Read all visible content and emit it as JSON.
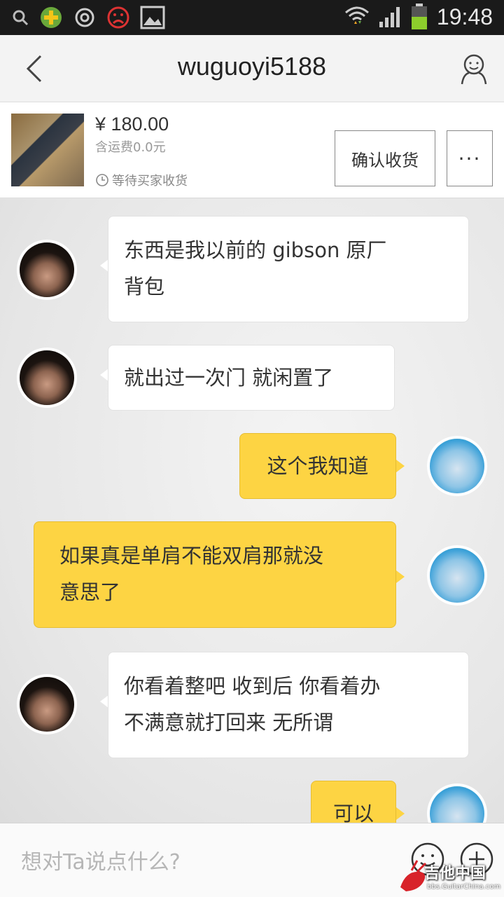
{
  "status_bar": {
    "time": "19:48",
    "icons": [
      "search-icon",
      "plus-app-icon",
      "weibo-icon",
      "sad-face-icon",
      "image-icon",
      "wifi-icon",
      "signal-icon",
      "battery-icon"
    ]
  },
  "header": {
    "title": "wuguoyi5188",
    "back_icon": "chevron-left-icon",
    "profile_icon": "user-profile-icon"
  },
  "product": {
    "price": "¥ 180.00",
    "shipping": "含运费0.0元",
    "status": "等待买家收货",
    "confirm_label": "确认收货",
    "more_label": "···"
  },
  "messages": [
    {
      "side": "in",
      "lines": [
        "东西是我以前的 gibson 原厂",
        "背包"
      ]
    },
    {
      "side": "in",
      "lines": [
        "就出过一次门 就闲置了"
      ]
    },
    {
      "side": "out",
      "lines": [
        "这个我知道"
      ]
    },
    {
      "side": "out",
      "lines": [
        "如果真是单肩不能双肩那就没",
        "意思了"
      ]
    },
    {
      "side": "in",
      "lines": [
        "你看着整吧 收到后 你看着办",
        "不满意就打回来 无所谓"
      ]
    },
    {
      "side": "out",
      "lines": [
        "可以"
      ]
    }
  ],
  "input": {
    "placeholder": "想对Ta说点什么?"
  },
  "watermark": {
    "text": "吉他中国",
    "sub": "bbs.GuitarChina.com"
  },
  "colors": {
    "outgoing_bubble": "#fdd443",
    "incoming_bubble": "#ffffff",
    "status_bar": "#1a1a1a"
  }
}
